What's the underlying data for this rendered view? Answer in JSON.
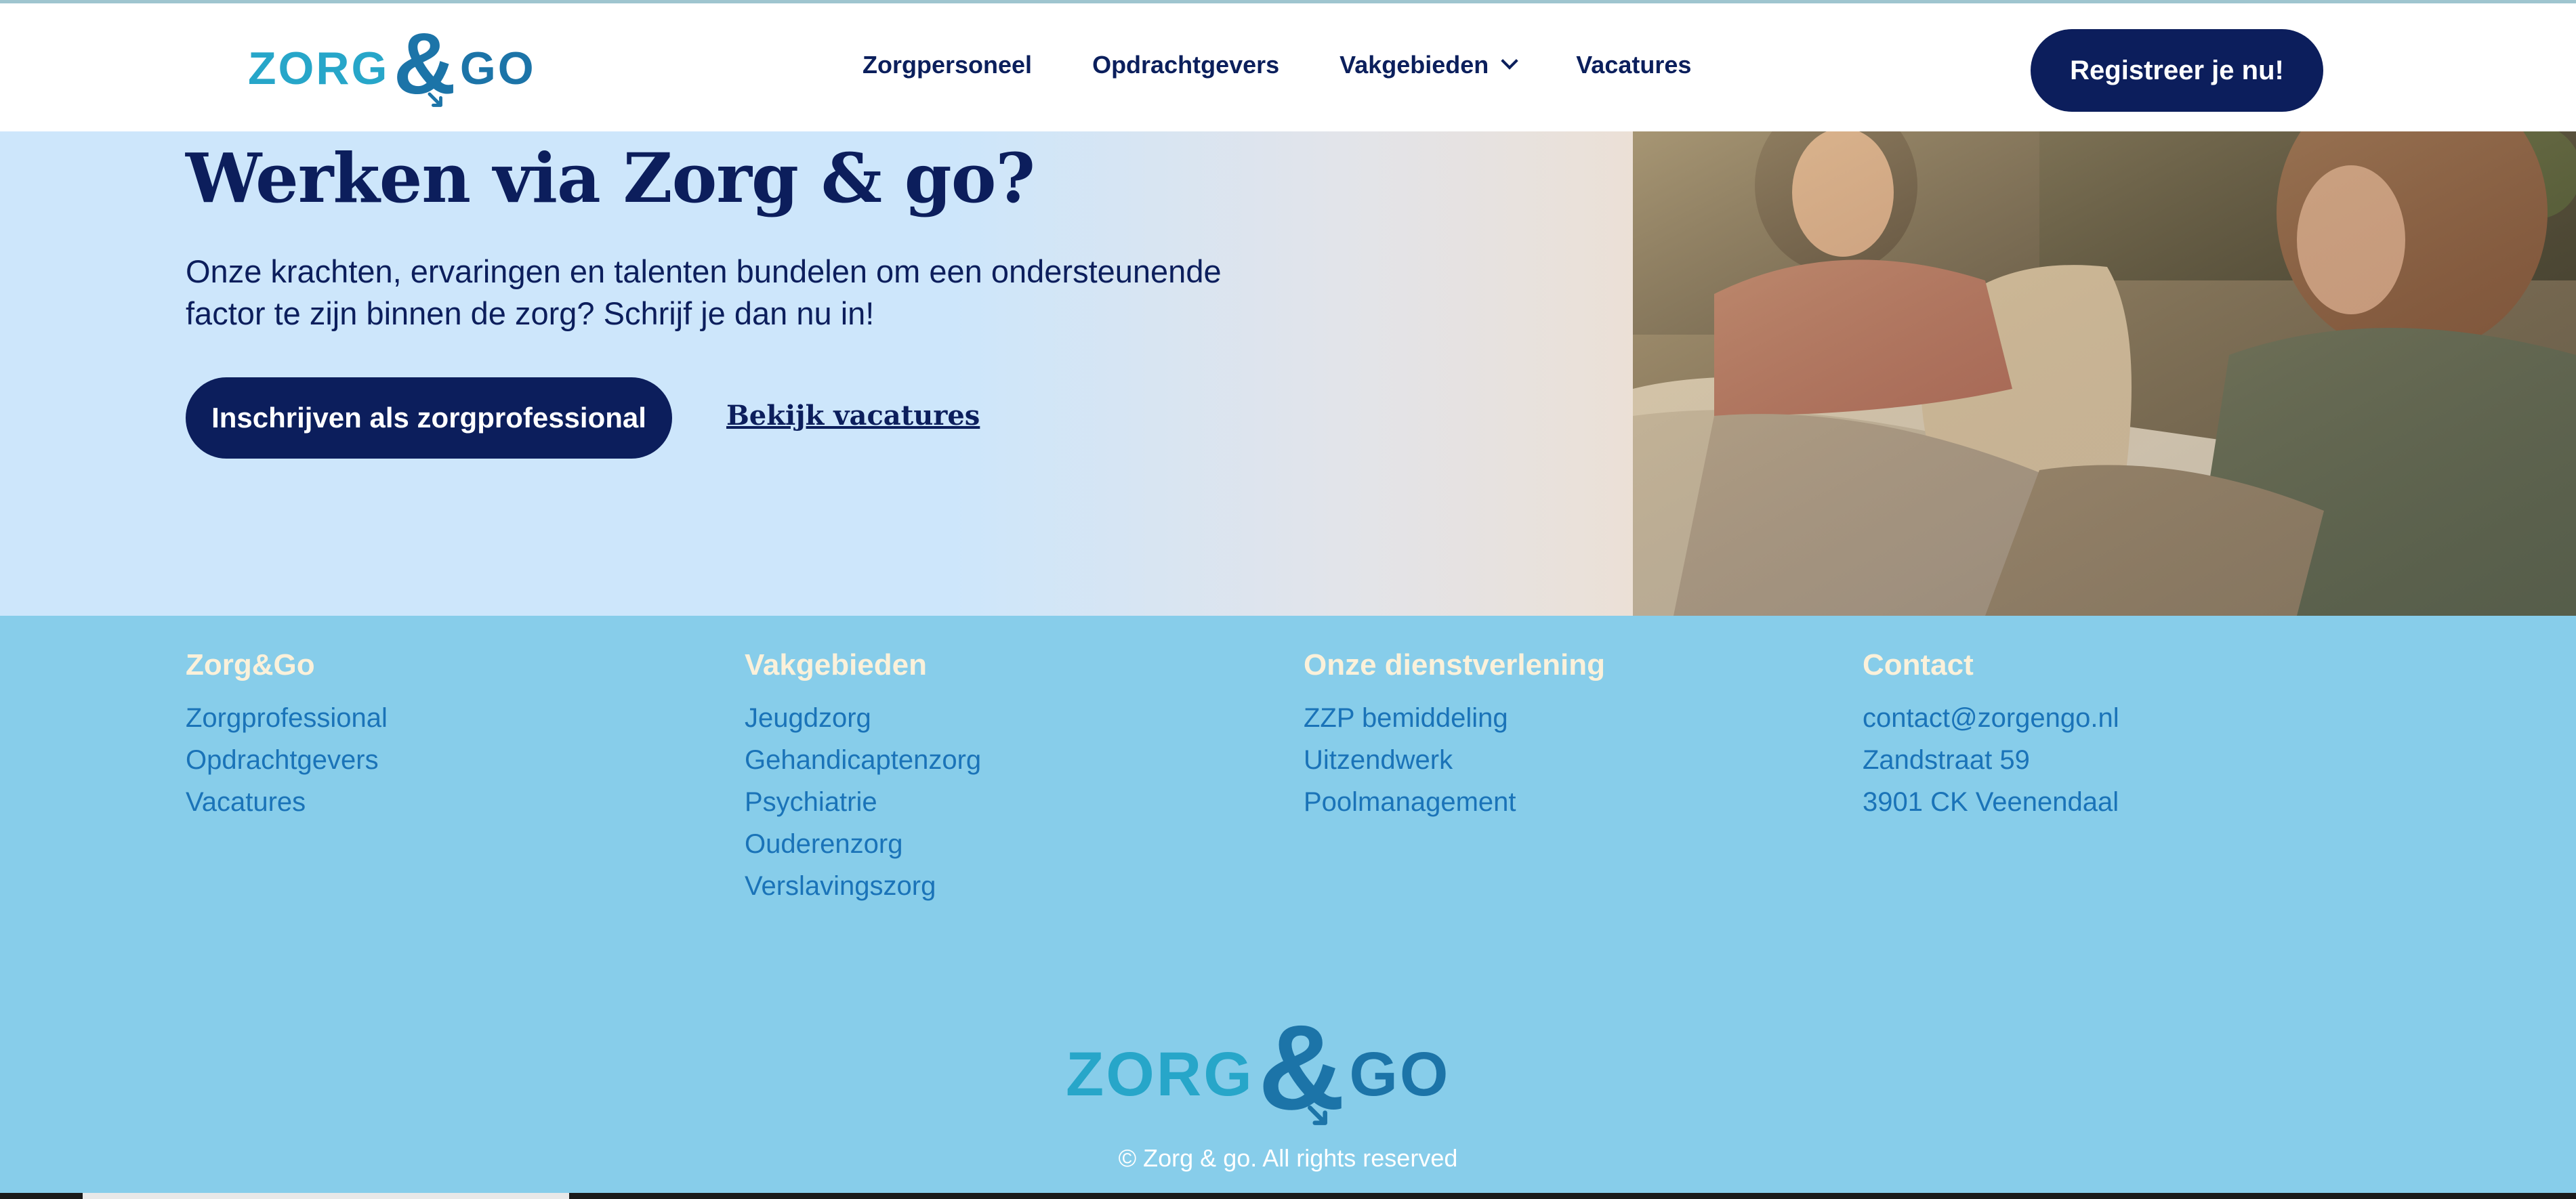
{
  "header": {
    "logo": {
      "zorg": "ZORG",
      "amp": "&",
      "go": "GO"
    },
    "nav": [
      {
        "label": "Zorgpersoneel"
      },
      {
        "label": "Opdrachtgevers"
      },
      {
        "label": "Vakgebieden",
        "has_dropdown": true
      },
      {
        "label": "Vacatures"
      }
    ],
    "cta_label": "Registreer je nu!"
  },
  "hero": {
    "title": "Werken via Zorg & go?",
    "subtitle": "Onze krachten, ervaringen en talenten bundelen om een ondersteunende factor te zijn binnen de zorg? Schrijf je dan nu in!",
    "primary_button": "Inschrijven als zorgprofessional",
    "secondary_link": "Bekijk vacatures"
  },
  "footer": {
    "columns": [
      {
        "heading": "Zorg&Go",
        "links": [
          "Zorgprofessional",
          "Opdrachtgevers",
          "Vacatures"
        ]
      },
      {
        "heading": "Vakgebieden",
        "links": [
          "Jeugdzorg",
          "Gehandicaptenzorg",
          "Psychiatrie",
          "Ouderenzorg",
          "Verslavingszorg"
        ]
      },
      {
        "heading": "Onze dienstverlening",
        "links": [
          "ZZP bemiddeling",
          "Uitzendwerk",
          "Poolmanagement"
        ]
      },
      {
        "heading": "Contact",
        "links": [
          "contact@zorgengo.nl",
          "Zandstraat 59",
          "3901 CK Veenendaal"
        ]
      }
    ],
    "logo": {
      "zorg": "ZORG",
      "amp": "&",
      "go": "GO"
    },
    "copyright": "© Zorg & go. All rights reserved"
  },
  "colors": {
    "navy": "#0c1e5c",
    "logo_light": "#27a6c9",
    "logo_dark": "#1c74a8",
    "hero_bg": "#cde6fb",
    "footer_bg": "#87cdea",
    "footer_heading": "#fbf1da",
    "footer_link": "#1a73b8"
  }
}
